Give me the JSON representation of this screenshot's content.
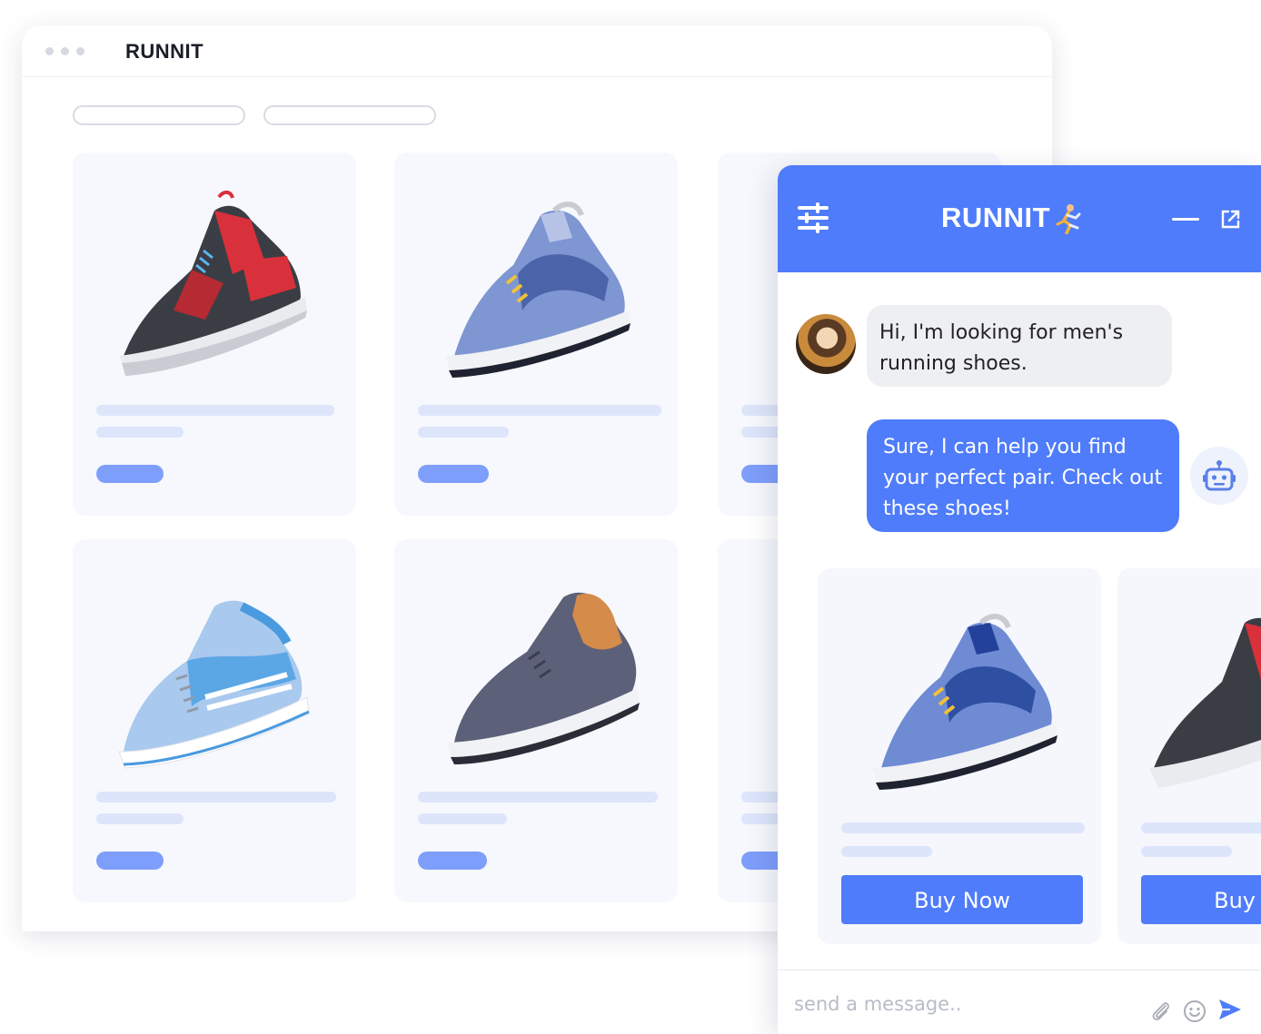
{
  "browser": {
    "title": "RUNNIT"
  },
  "chat": {
    "title": "RUNNIT",
    "header_icons": [
      "sliders-icon",
      "running-person-icon",
      "minimize-icon",
      "external-link-icon"
    ],
    "messages": [
      {
        "from": "user",
        "text": "Hi, I'm looking for men's running shoes."
      },
      {
        "from": "bot",
        "text": "Sure, I can help you find your perfect pair. Check out these shoes!"
      }
    ],
    "products": [
      {
        "button_label": "Buy Now"
      },
      {
        "button_label": "Buy Now"
      }
    ],
    "composer": {
      "placeholder": "send a message..",
      "icons": [
        "paperclip-icon",
        "emoji-icon",
        "send-icon"
      ]
    }
  },
  "colors": {
    "accent": "#4f7cfa",
    "placeholder_bar": "#dde5fb",
    "placeholder_pill": "#7e9efb",
    "card_bg": "#f6f8fd"
  }
}
